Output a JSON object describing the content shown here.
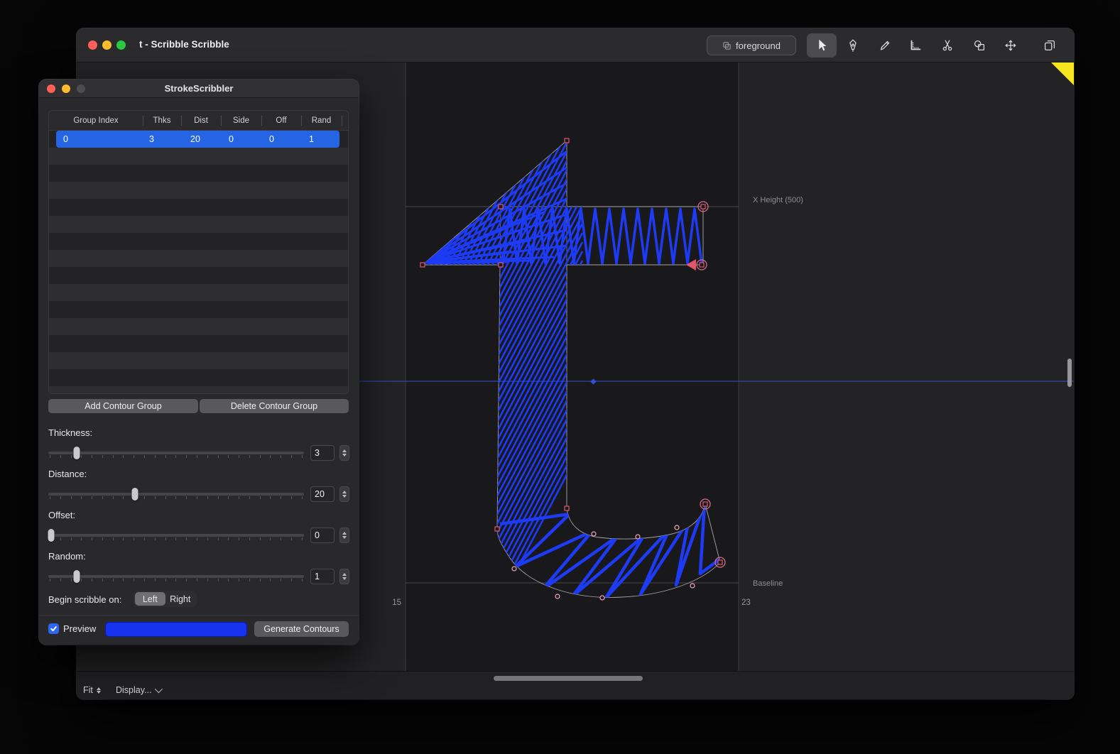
{
  "window": {
    "title": "t - Scribble Scribble",
    "foreground_button": "foreground",
    "tools": [
      {
        "name": "move-tool",
        "selected": true
      },
      {
        "name": "pen-tool",
        "selected": false
      },
      {
        "name": "pencil-tool",
        "selected": false
      },
      {
        "name": "measure-tool",
        "selected": false
      },
      {
        "name": "knife-tool",
        "selected": false
      },
      {
        "name": "shapes-tool",
        "selected": false
      },
      {
        "name": "transform-tool",
        "selected": false
      },
      {
        "name": "copy-tool",
        "selected": false
      }
    ],
    "bottom_bar": {
      "fit": "Fit",
      "display": "Display..."
    }
  },
  "canvas": {
    "x_height_label": "X Height (500)",
    "baseline_label": "Baseline",
    "left_number": "15",
    "right_number": "23",
    "colors": {
      "scribble": "#1d3bf5",
      "guide": "#2e4fd6",
      "outline": "#a5a5a9",
      "corner_point": "#e0566b",
      "smooth_point": "#efa9bd",
      "selected_ring": "#d36a8a"
    }
  },
  "panel": {
    "title": "StrokeScribbler",
    "table": {
      "columns": [
        "Group Index",
        "Thks",
        "Dist",
        "Side",
        "Off",
        "Rand"
      ],
      "selected_row": [
        "0",
        "3",
        "20",
        "0",
        "0",
        "1"
      ]
    },
    "add_button": "Add Contour Group",
    "delete_button": "Delete Contour Group",
    "sliders": [
      {
        "label": "Thickness:",
        "value": "3"
      },
      {
        "label": "Distance:",
        "value": "20"
      },
      {
        "label": "Offset:",
        "value": "0"
      },
      {
        "label": "Random:",
        "value": "1"
      }
    ],
    "begin_label": "Begin scribble on:",
    "segments": [
      "Left",
      "Right"
    ],
    "selected_segment": "Left",
    "preview_label": "Preview",
    "preview_checked": true,
    "preview_color": "#1733f0",
    "generate_button": "Generate Contours",
    "selection_color": "#2565e4"
  }
}
